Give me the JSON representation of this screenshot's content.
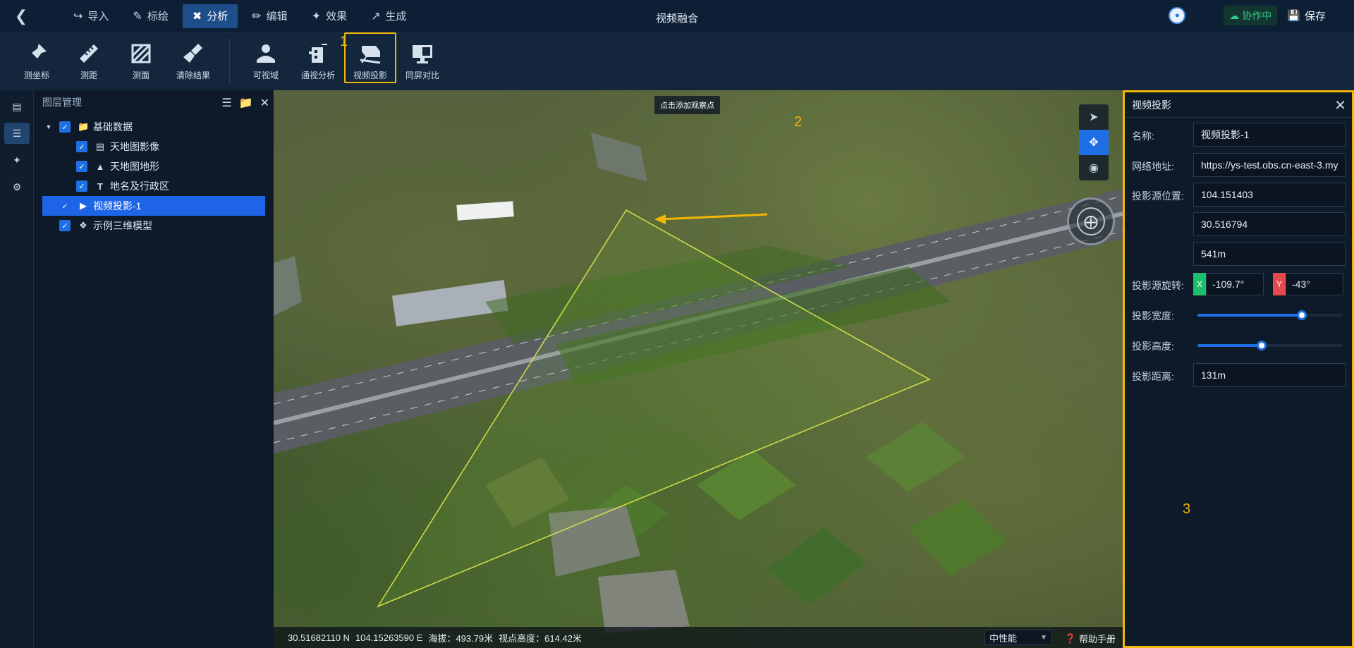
{
  "window": {
    "title": "视频融合"
  },
  "menu": [
    {
      "label": "导入",
      "icon": "import-icon"
    },
    {
      "label": "标绘",
      "icon": "plot-icon"
    },
    {
      "label": "分析",
      "icon": "analysis-icon",
      "active": true
    },
    {
      "label": "编辑",
      "icon": "edit-icon"
    },
    {
      "label": "效果",
      "icon": "effect-icon"
    },
    {
      "label": "生成",
      "icon": "generate-icon"
    }
  ],
  "header_right": {
    "collab": "协作中",
    "save": "保存"
  },
  "toolbar": {
    "measure_coord": "测坐标",
    "measure_distance": "测距",
    "measure_area": "测面",
    "clear_results": "清除结果",
    "viewshed": "可视域",
    "visibility_analysis": "通视分析",
    "video_projection": "视频投影",
    "split_compare": "同屏对比"
  },
  "annotations": {
    "m1": "1",
    "m2": "2",
    "m3": "3"
  },
  "layer_panel": {
    "title": "图层管理",
    "group": "基础数据",
    "items": [
      "天地图影像",
      "天地图地形",
      "地名及行政区"
    ],
    "projection": "视频投影-1",
    "model": "示例三维模型"
  },
  "map": {
    "tooltip": "点击添加观察点",
    "status": {
      "lat": "30.51682110 N",
      "lon": "104.15263590 E",
      "altitude": "海拔：493.79米",
      "view_height": "视点高度：614.42米"
    },
    "performance": "中性能",
    "help": "帮助手册"
  },
  "projection_panel": {
    "title": "视频投影",
    "name_label": "名称:",
    "name_value": "视频投影-1",
    "url_label": "网络地址:",
    "url_value": "https://ys-test.obs.cn-east-3.my",
    "position_label": "投影源位置:",
    "position_lon": "104.151403",
    "position_lat": "30.516794",
    "position_height": "541m",
    "rotation_label": "投影源旋转:",
    "rotation_x_tag": "X",
    "rotation_x": "-109.7°",
    "rotation_y_tag": "Y",
    "rotation_y": "-43°",
    "width_label": "投影宽度:",
    "width_level": 0.72,
    "height_label": "投影高度:",
    "height_level": 0.44,
    "distance_label": "投影距离:",
    "distance_value": "131m"
  },
  "colors": {
    "accent": "#1f6fe5",
    "highlight": "#f2b705",
    "collab": "#32c98a",
    "axis_x": "#1bbf6a",
    "axis_y": "#e5484d"
  }
}
